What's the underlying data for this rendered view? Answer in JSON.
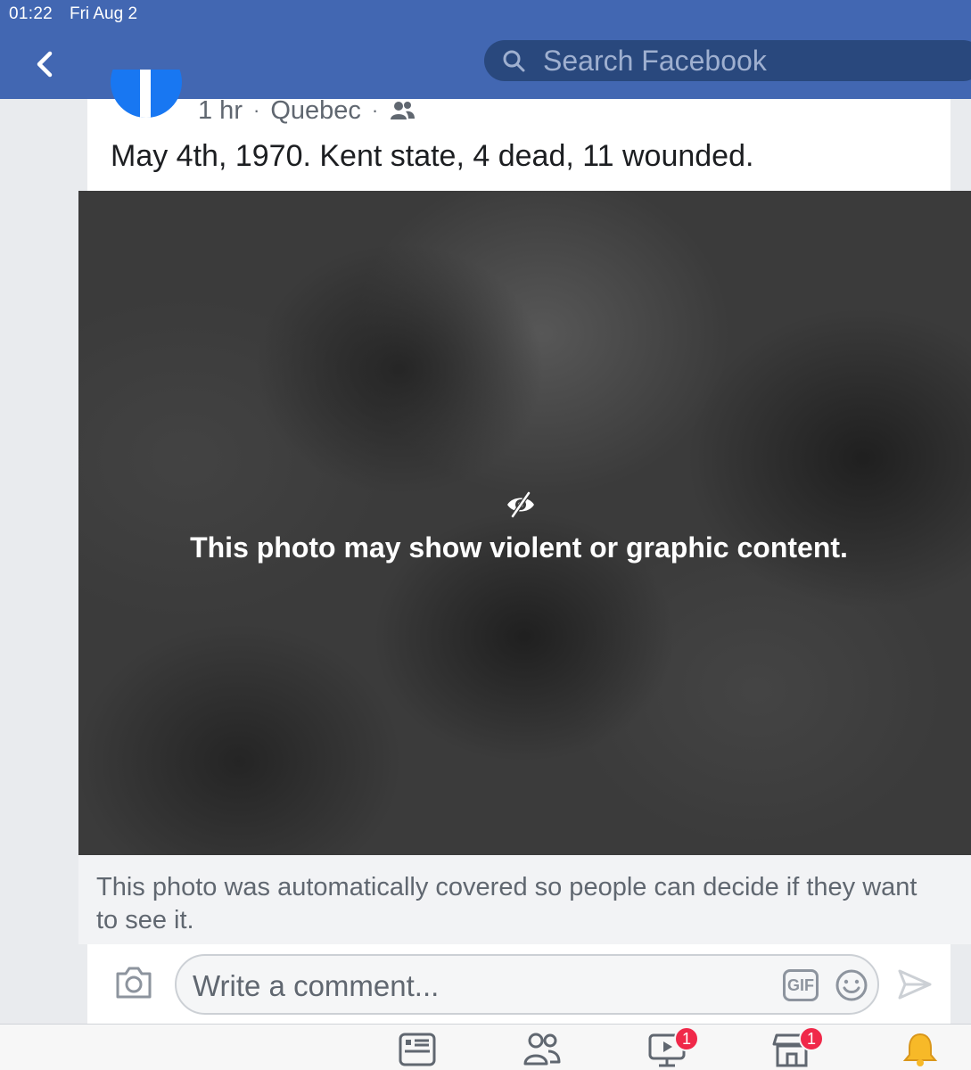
{
  "status_bar": {
    "time": "01:22",
    "date": "Fri Aug 2"
  },
  "header": {
    "back_icon": "chevron-left-icon",
    "search_placeholder": "Search Facebook",
    "search_icon": "search-icon",
    "bar_color": "#4267b2"
  },
  "post": {
    "time": "1 hr",
    "location": "Quebec",
    "separator": "·",
    "audience_icon": "friends-icon",
    "text": "May 4th, 1970. Kent state, 4 dead, 11 wounded.",
    "photo": {
      "icon": "eye-slash-icon",
      "warning": "This photo may show violent or graphic content."
    },
    "caption": "This photo was automatically covered so people can decide if they want to see it."
  },
  "comment_bar": {
    "placeholder": "Write a comment...",
    "gif_label": "GIF",
    "icons": [
      "camera-icon",
      "gif-icon",
      "emoji-icon",
      "send-icon"
    ]
  },
  "tab_bar": {
    "tabs": [
      {
        "icon": "news-feed-icon"
      },
      {
        "icon": "friends-icon"
      },
      {
        "icon": "watch-icon",
        "badge": "1"
      },
      {
        "icon": "marketplace-icon",
        "badge": "1"
      },
      {
        "icon": "notifications-icon"
      }
    ],
    "badge_color": "#f02849"
  }
}
